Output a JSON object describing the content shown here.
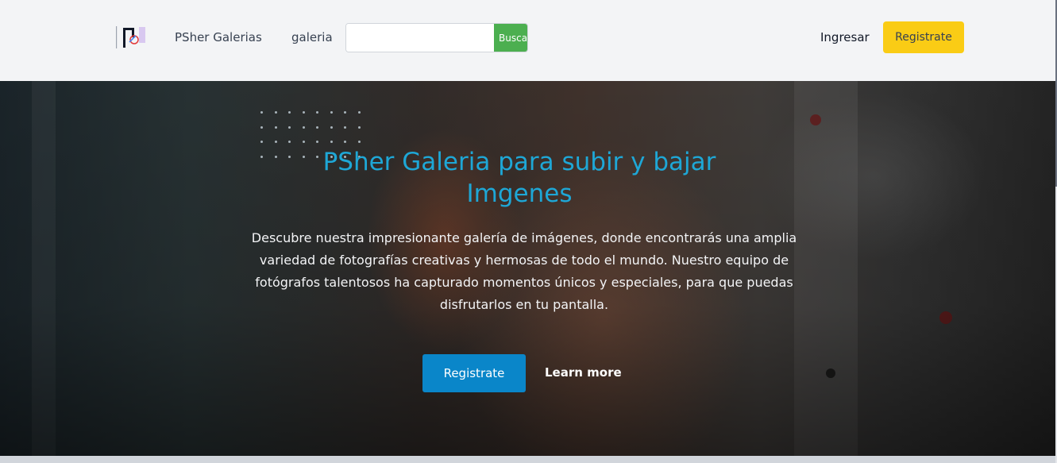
{
  "header": {
    "brand": "PSher Galerias",
    "nav_link": "galeria",
    "search": {
      "value": "",
      "placeholder": "",
      "button_label": "Buscar"
    },
    "login_label": "Ingresar",
    "register_label": "Registrate"
  },
  "hero": {
    "title": "PSher Galeria para subir y bajar Imgenes",
    "description": "Descubre nuestra impresionante galería de imágenes, donde encontrarás una amplia variedad de fotografías creativas y hermosas de todo el mundo. Nuestro equipo de fotógrafos talentosos ha capturado momentos únicos y especiales, para que puedas disfrutarlos en tu pantalla.",
    "primary_button": "Registrate",
    "secondary_link": "Learn more"
  },
  "colors": {
    "search_button": "#4caf50",
    "register_button": "#facc15",
    "hero_title": "#1ea7d6",
    "hero_button": "#0a86c9"
  },
  "icons": {
    "logo": "psher-logo-icon"
  }
}
